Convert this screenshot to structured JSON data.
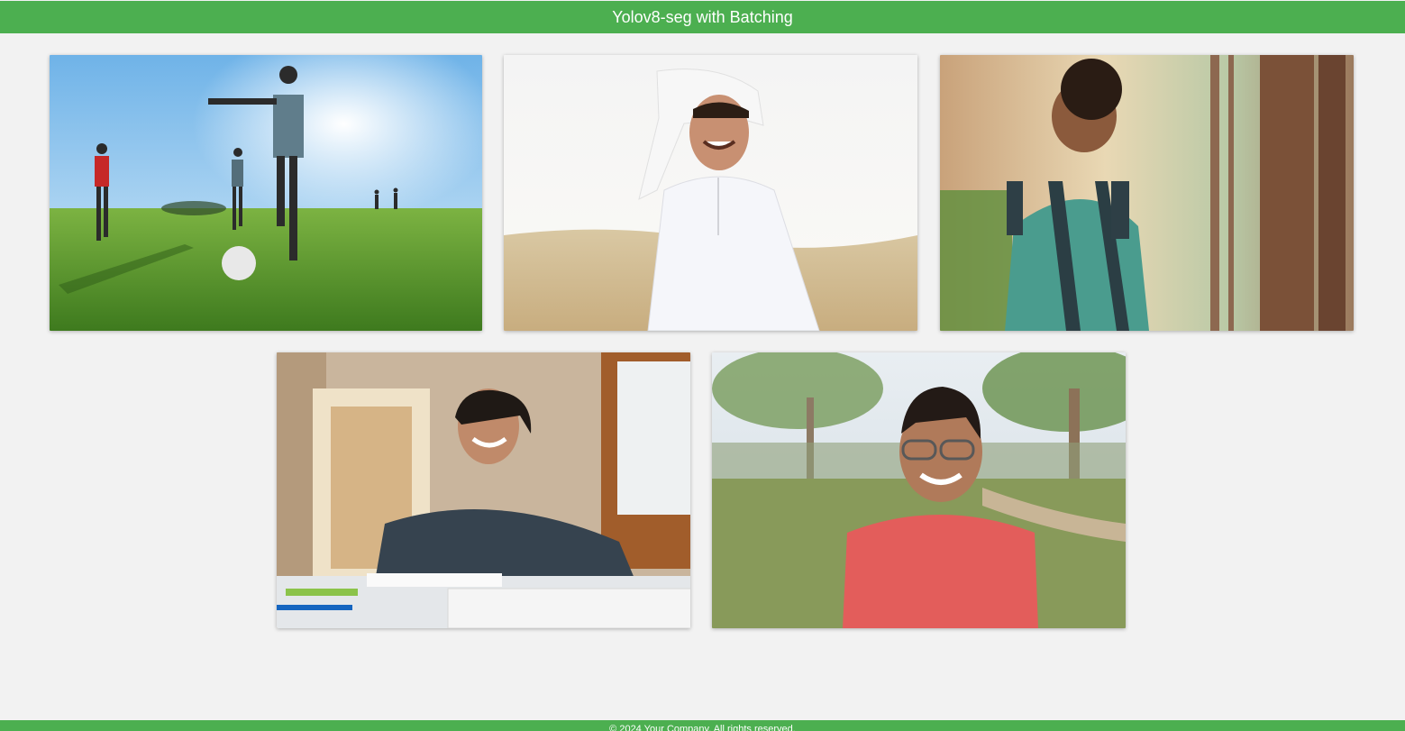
{
  "header": {
    "title": "Yolov8-seg with Batching"
  },
  "gallery": {
    "images": [
      {
        "name": "soccer-kids-photo",
        "description_icon": "image-icon"
      },
      {
        "name": "desert-boy-photo",
        "description_icon": "image-icon"
      },
      {
        "name": "forest-backpack-boy-photo",
        "description_icon": "image-icon"
      },
      {
        "name": "studying-teen-photo",
        "description_icon": "image-icon"
      },
      {
        "name": "park-boy-glasses-photo",
        "description_icon": "image-icon"
      }
    ]
  },
  "footer": {
    "text": "© 2024 Your Company. All rights reserved."
  },
  "colors": {
    "accent": "#4caf50",
    "background": "#f2f2f2"
  }
}
